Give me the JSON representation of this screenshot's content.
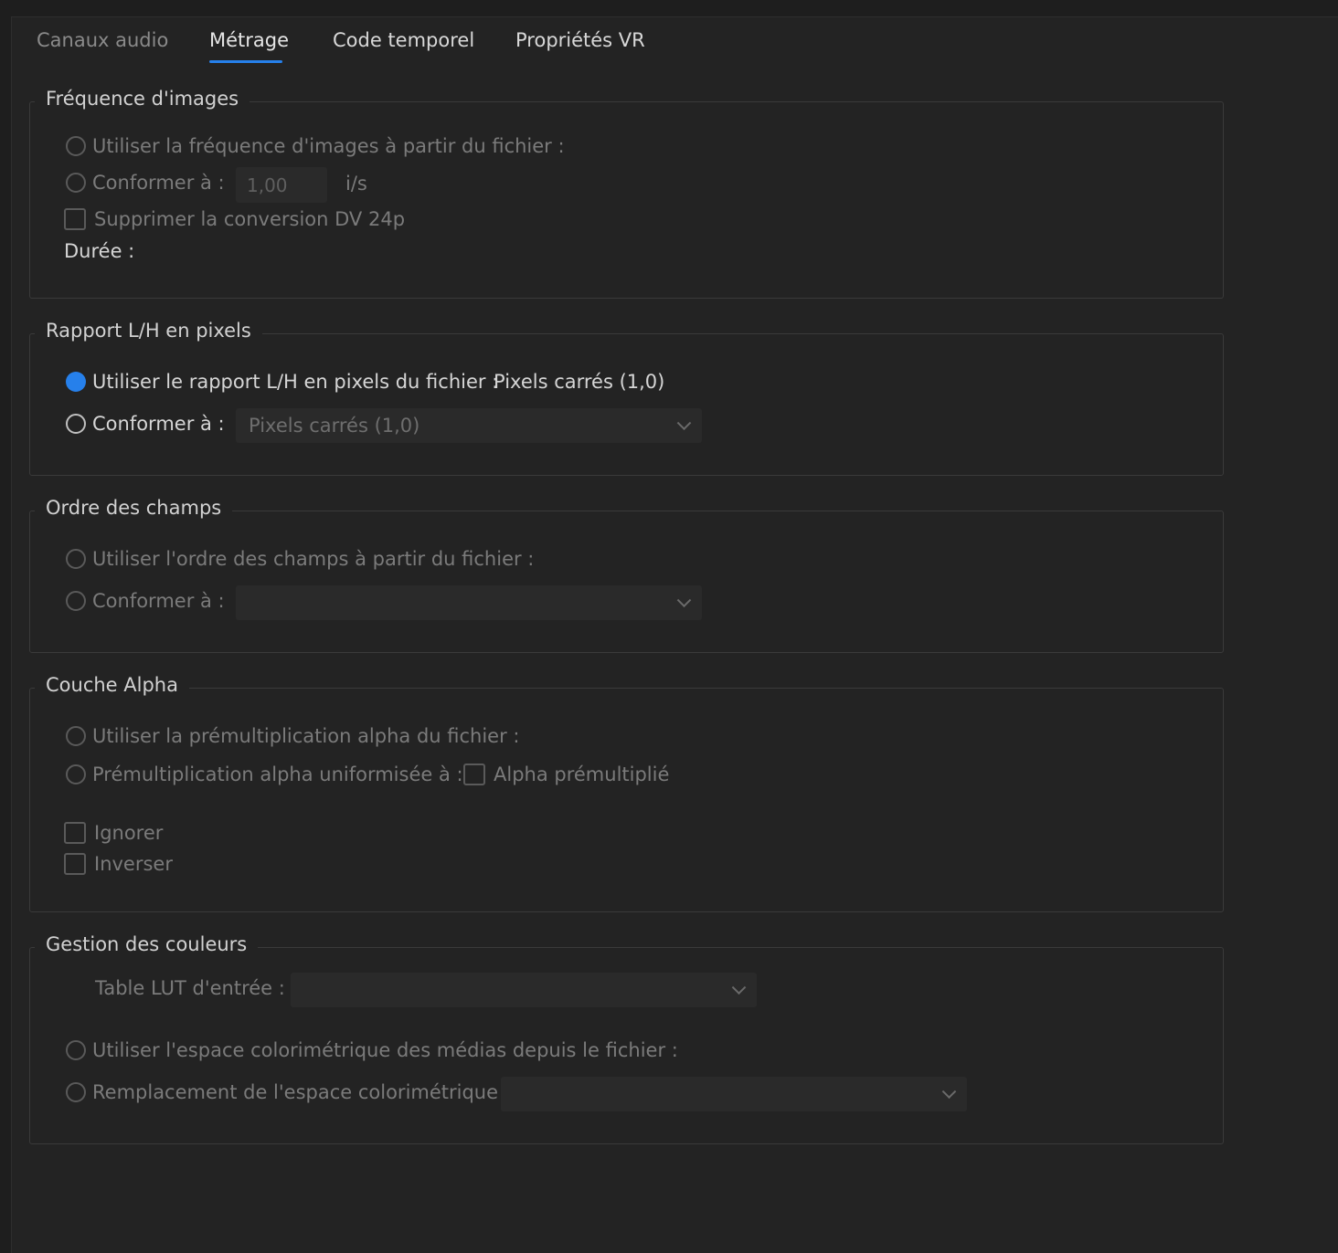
{
  "tabs": [
    {
      "label": "Canaux audio"
    },
    {
      "label": "Métrage"
    },
    {
      "label": "Code temporel"
    },
    {
      "label": "Propriétés VR"
    }
  ],
  "accent_color": "#2680eb",
  "frame_rate": {
    "legend": "Fréquence d'images",
    "use_file": "Utiliser la fréquence d'images à partir du fichier :",
    "conform_label": "Conformer à :",
    "conform_value": "1,00",
    "unit": "i/s",
    "remove_dv": "Supprimer la conversion DV 24p",
    "duration_label": "Durée :"
  },
  "pixel_aspect": {
    "legend": "Rapport L/H en pixels",
    "use_file": "Utiliser le rapport L/H en pixels du fichier :",
    "use_file_value": "Pixels carrés (1,0)",
    "conform_label": "Conformer à :",
    "conform_value": "Pixels carrés (1,0)"
  },
  "field_order": {
    "legend": "Ordre des champs",
    "use_file": "Utiliser l'ordre des champs à partir du fichier :",
    "conform_label": "Conformer à :"
  },
  "alpha": {
    "legend": "Couche Alpha",
    "use_file": "Utiliser la prémultiplication alpha du fichier :",
    "uniform": "Prémultiplication alpha uniformisée à :",
    "premultiplied": "Alpha prémultiplié",
    "ignore": "Ignorer",
    "invert": "Inverser"
  },
  "color": {
    "legend": "Gestion des couleurs",
    "lut_label": "Table LUT d'entrée :",
    "use_file": "Utiliser l'espace colorimétrique des médias depuis le fichier :",
    "override": "Remplacement de l'espace colorimétrique :"
  }
}
